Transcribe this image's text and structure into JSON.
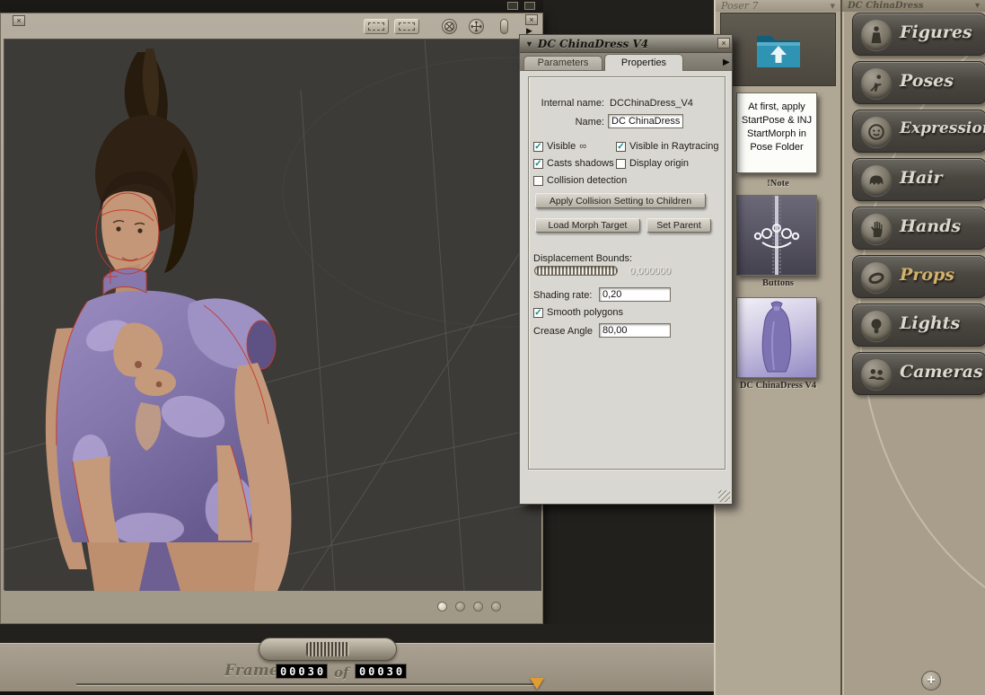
{
  "icons": {
    "collapse_triangle": "▼",
    "overflow_arrow": "▶",
    "play_arrow": "▶",
    "dropdown_chevron": "▾",
    "close_glyph": "×",
    "plus_glyph": "+",
    "visible_infinity": "∞"
  },
  "colors": {
    "accent_gold": "#d3b26b",
    "check_teal": "#0d8c8c",
    "marker_orange": "#df9c32",
    "folder_teal": "#2f93b4",
    "dress_purple": "#8376ab"
  },
  "library_headers": {
    "left": {
      "label": "Poser 7"
    },
    "right": {
      "label": "DC ChinaDress"
    }
  },
  "properties_panel": {
    "title": "DC ChinaDress V4",
    "tabs": [
      {
        "label": "Parameters"
      },
      {
        "label": "Properties"
      }
    ],
    "internal_name_label": "Internal name:",
    "internal_name_value": "DCChinaDress_V4",
    "name_label": "Name:",
    "name_value": "DC ChinaDress",
    "checkboxes": [
      {
        "label": "Visible",
        "mark": "✓"
      },
      {
        "label": "Visible in Raytracing",
        "mark": "✓"
      },
      {
        "label": "Casts shadows",
        "mark": "✓"
      },
      {
        "label": "Display origin",
        "mark": ""
      },
      {
        "label": "Collision detection",
        "mark": ""
      },
      {
        "label": "Smooth polygons",
        "mark": "✓"
      }
    ],
    "buttons": {
      "apply_collision": "Apply Collision Setting to Children",
      "load_morph": "Load Morph Target",
      "set_parent": "Set Parent"
    },
    "displacement_bounds_label": "Displacement Bounds:",
    "displacement_bounds_value": "0,000000",
    "shading_rate_label": "Shading rate:",
    "shading_rate_value": "0,20",
    "crease_angle_label": "Crease Angle",
    "crease_angle_value": "80,00"
  },
  "library": {
    "note_text": "At first, apply StartPose & INJ StartMorph in Pose Folder",
    "items": [
      {
        "label": "!Note"
      },
      {
        "label": "Buttons"
      },
      {
        "label": "DC ChinaDress V4"
      }
    ]
  },
  "sidebar": {
    "active_item": "Props",
    "items": [
      {
        "label": "Figures"
      },
      {
        "label": "Poses"
      },
      {
        "label": "Expression"
      },
      {
        "label": "Hair"
      },
      {
        "label": "Hands"
      },
      {
        "label": "Props"
      },
      {
        "label": "Lights"
      },
      {
        "label": "Cameras"
      }
    ]
  },
  "timeline": {
    "frame_label": "Frame:",
    "current_frame": "00030",
    "of_label": "of",
    "total_frame": "00030"
  }
}
